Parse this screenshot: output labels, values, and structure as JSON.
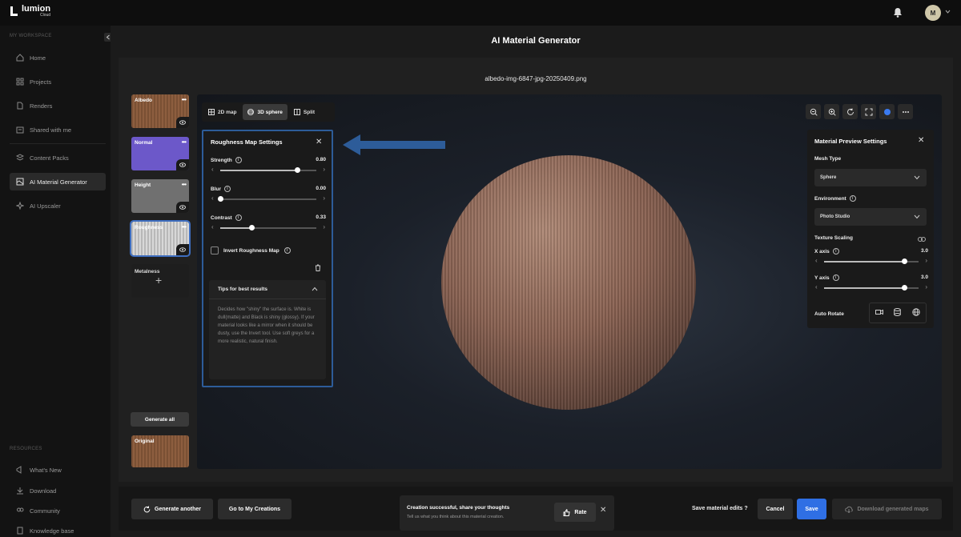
{
  "app": {
    "logo_text": "lumion",
    "logo_sub": "Cloud",
    "user_initial": "M"
  },
  "sidebar": {
    "section_workspace": "MY WORKSPACE",
    "items": [
      {
        "label": "Home",
        "icon": "home-icon"
      },
      {
        "label": "Projects",
        "icon": "grid-icon"
      },
      {
        "label": "Renders",
        "icon": "file-icon"
      },
      {
        "label": "Shared with me",
        "icon": "share-icon"
      },
      {
        "label": "Content Packs",
        "icon": "layers-icon"
      },
      {
        "label": "AI Material Generator",
        "icon": "material-icon",
        "active": true
      },
      {
        "label": "AI Upscaler",
        "icon": "sparkle-icon"
      }
    ],
    "section_resources": "RESOURCES",
    "resources": [
      {
        "label": "What's New",
        "icon": "megaphone-icon"
      },
      {
        "label": "Download",
        "icon": "download-icon"
      },
      {
        "label": "Community",
        "icon": "community-icon"
      },
      {
        "label": "Knowledge base",
        "icon": "book-icon"
      }
    ]
  },
  "page": {
    "title": "AI Material Generator",
    "file_name": "albedo-img-6847-jpg-20250409.png"
  },
  "maps": {
    "albedo": "Albedo",
    "normal": "Normal",
    "height": "Height",
    "roughness": "Roughness",
    "metalness": "Metalness",
    "generate_all": "Generate all",
    "original": "Original"
  },
  "view_tabs": [
    {
      "label": "2D map",
      "active": false
    },
    {
      "label": "3D sphere",
      "active": true
    },
    {
      "label": "Split",
      "active": false
    }
  ],
  "roughness_panel": {
    "title": "Roughness Map Settings",
    "strength_label": "Strength",
    "strength_value": "0.80",
    "strength": 0.8,
    "blur_label": "Blur",
    "blur_value": "0.00",
    "blur": 0.0,
    "contrast_label": "Contrast",
    "contrast_value": "0.33",
    "contrast": 0.33,
    "invert_label": "Invert Roughness Map",
    "tips_title": "Tips for best results",
    "tips_text": "Decides how \"shiny\" the surface is. White is dull(matte) and Black is shiny (glossy). If your material looks like a mirror when it should be dusty, use the Invert tool. Use soft greys for a more realistic, natural finish."
  },
  "preview_settings": {
    "title": "Material Preview Settings",
    "mesh_type_label": "Mesh Type",
    "mesh_type_value": "Sphere",
    "environment_label": "Environment",
    "environment_value": "Photo Studio",
    "texture_scaling_label": "Texture Scaling",
    "x_axis_label": "X axis",
    "x_axis_value": "3.0",
    "x_axis": 0.85,
    "y_axis_label": "Y axis",
    "y_axis_value": "3.0",
    "y_axis": 0.85,
    "auto_rotate_label": "Auto Rotate"
  },
  "bottom": {
    "generate_another": "Generate another",
    "go_to_creations": "Go to My Creations",
    "feedback_title": "Creation successful, share your thoughts",
    "feedback_sub": "Tell us what you think about this material creation.",
    "rate": "Rate",
    "save_question": "Save material edits ?",
    "cancel": "Cancel",
    "save": "Save",
    "download": "Download generated maps"
  },
  "colors": {
    "accent_blue": "#2f6fe4",
    "highlight_border": "#2d5c99",
    "normal_map": "#6c58c9"
  }
}
